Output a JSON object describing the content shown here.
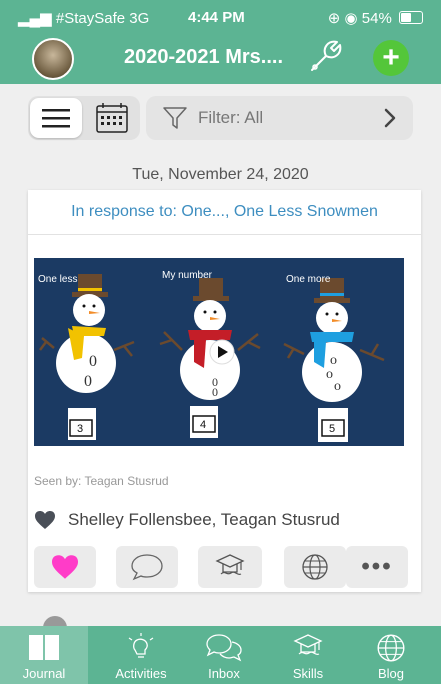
{
  "status_bar": {
    "carrier": "#StaySafe 3G",
    "time": "4:44 PM",
    "battery": "54%",
    "battery_level": 0.54
  },
  "header": {
    "title": "2020-2021 Mrs...."
  },
  "filter": {
    "label": "Filter: All"
  },
  "date": "Tue, November 24, 2020",
  "post": {
    "response": "In response to: One..., One Less Snowmen",
    "media": {
      "labels": [
        "One less",
        "My number",
        "One more"
      ],
      "numbers": [
        "3",
        "4",
        "5"
      ]
    },
    "seen_by": "Seen by: Teagan Stusrud",
    "likes": "Shelley Follensbee, Teagan Stusrud"
  },
  "tabs": [
    {
      "label": "Journal",
      "icon": "book-icon"
    },
    {
      "label": "Activities",
      "icon": "lightbulb-icon"
    },
    {
      "label": "Inbox",
      "icon": "chat-bubbles-icon"
    },
    {
      "label": "Skills",
      "icon": "graduation-cap-icon"
    },
    {
      "label": "Blog",
      "icon": "globe-icon"
    }
  ],
  "colors": {
    "brand": "#5cb493",
    "add": "#54c63a",
    "heart": "#ff3cc8",
    "link": "#3e8ec0"
  }
}
